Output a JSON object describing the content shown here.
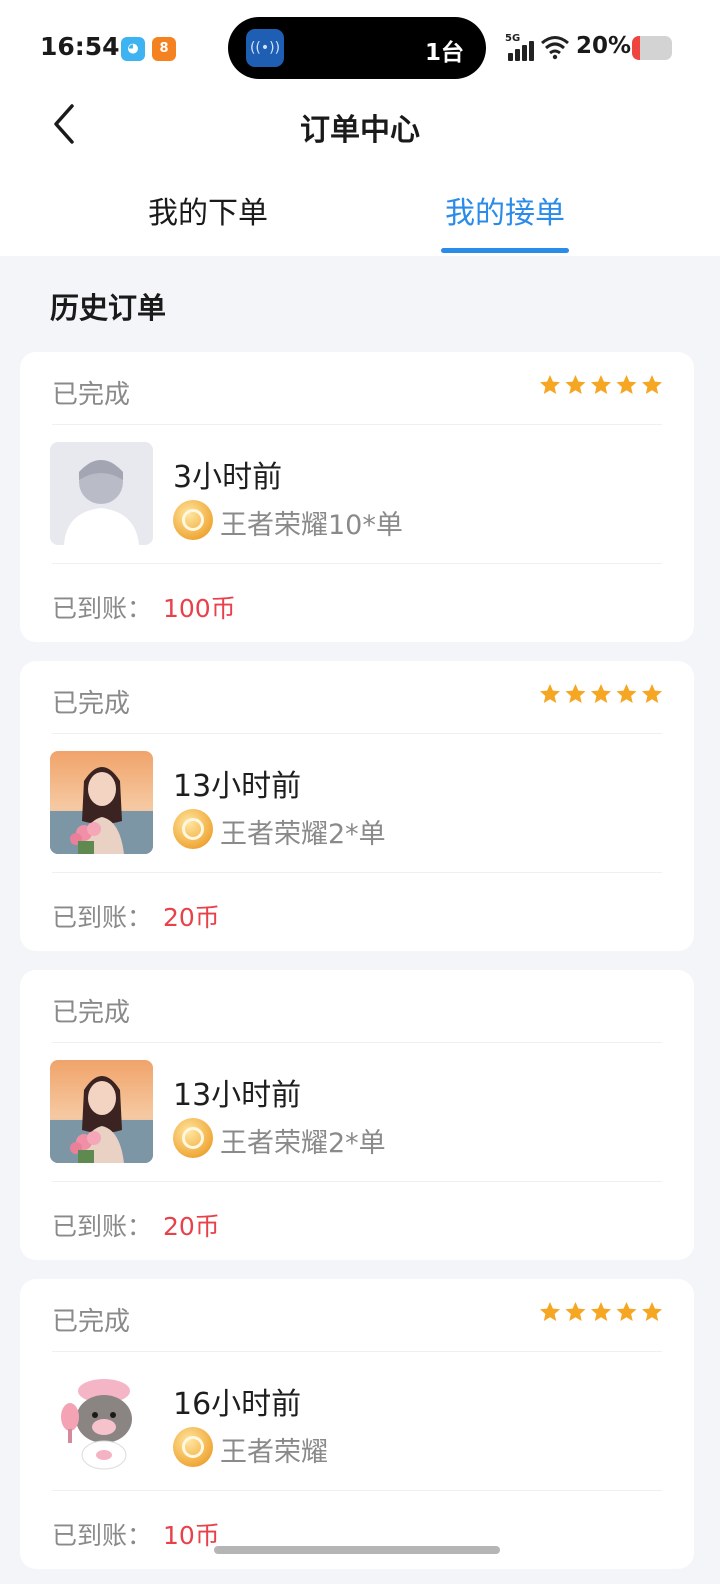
{
  "status_bar": {
    "time": "16:54",
    "island_count": "1台",
    "signal": "5G",
    "battery_pct": "20%",
    "battery_level": 0.2,
    "battery_color": "#f0443f"
  },
  "nav": {
    "title": "订单中心",
    "back_icon": "chevron-left-icon"
  },
  "tabs": [
    {
      "label": "我的下单",
      "active": false
    },
    {
      "label": "我的接单",
      "active": true
    }
  ],
  "accent_color": "#2a8be8",
  "section_title": "历史订单",
  "orders": [
    {
      "status": "已完成",
      "rating": 5,
      "avatar": "default-avatar",
      "time_ago": "3小时前",
      "service": "王者荣耀10*单",
      "paid_label": "已到账：",
      "paid_amount": "100币"
    },
    {
      "status": "已完成",
      "rating": 5,
      "avatar": "photo-avatar",
      "time_ago": "13小时前",
      "service": "王者荣耀2*单",
      "paid_label": "已到账：",
      "paid_amount": "20币"
    },
    {
      "status": "已完成",
      "rating": null,
      "avatar": "photo-avatar",
      "time_ago": "13小时前",
      "service": "王者荣耀2*单",
      "paid_label": "已到账：",
      "paid_amount": "20币"
    },
    {
      "status": "已完成",
      "rating": 5,
      "avatar": "cartoon-avatar",
      "time_ago": "16小时前",
      "service": "王者荣耀",
      "paid_label": "已到账：",
      "paid_amount": "10币"
    }
  ]
}
